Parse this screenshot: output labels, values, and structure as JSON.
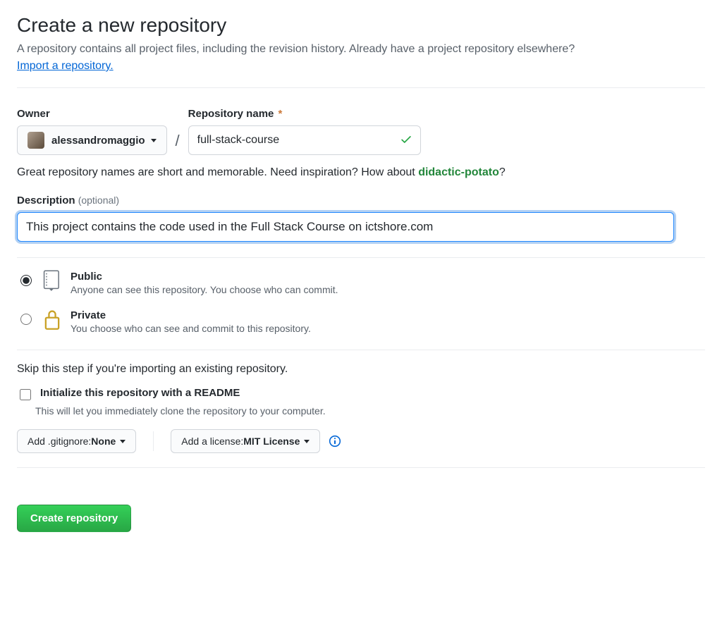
{
  "header": {
    "title": "Create a new repository",
    "subtitle": "A repository contains all project files, including the revision history. Already have a project repository elsewhere?",
    "import_link": "Import a repository."
  },
  "owner": {
    "label": "Owner",
    "username": "alessandromaggio"
  },
  "repo": {
    "label": "Repository name",
    "value": "full-stack-course"
  },
  "hint": {
    "prefix": "Great repository names are short and memorable. Need inspiration? How about ",
    "suggestion": "didactic-potato",
    "suffix": "?"
  },
  "description": {
    "label": "Description",
    "optional": "(optional)",
    "value": "This project contains the code used in the Full Stack Course on ictshore.com"
  },
  "visibility": {
    "public": {
      "title": "Public",
      "sub": "Anyone can see this repository. You choose who can commit."
    },
    "private": {
      "title": "Private",
      "sub": "You choose who can see and commit to this repository."
    }
  },
  "init": {
    "skip_note": "Skip this step if you're importing an existing repository.",
    "readme_label": "Initialize this repository with a README",
    "readme_sub": "This will let you immediately clone the repository to your computer."
  },
  "dropdowns": {
    "gitignore_prefix": "Add .gitignore: ",
    "gitignore_value": "None",
    "license_prefix": "Add a license: ",
    "license_value": "MIT License"
  },
  "submit": {
    "label": "Create repository"
  }
}
